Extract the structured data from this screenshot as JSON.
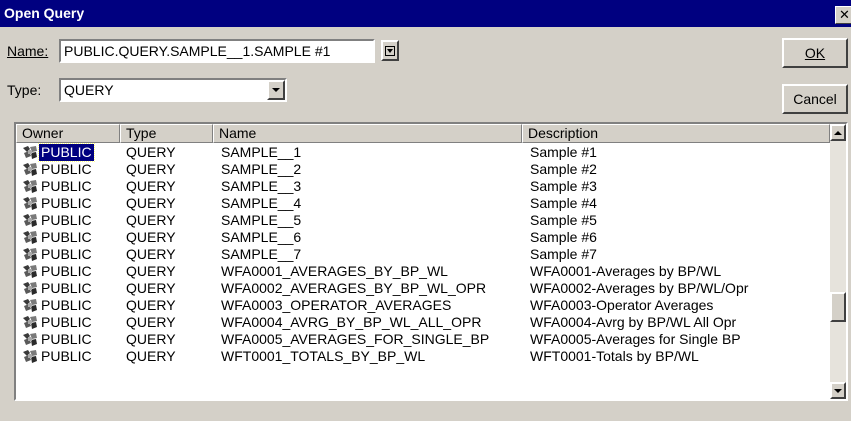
{
  "dialog": {
    "title": "Open Query",
    "close_glyph": "✕",
    "colors": {
      "titlebar": "#000080",
      "face": "#d4d0c8",
      "selection": "#000080"
    }
  },
  "form": {
    "name_label": "Name:",
    "name_value": "PUBLIC.QUERY.SAMPLE__1.SAMPLE #1",
    "type_label": "Type:",
    "type_value": "QUERY"
  },
  "buttons": {
    "ok": "OK",
    "cancel": "Cancel"
  },
  "list": {
    "columns": [
      "Owner",
      "Type",
      "Name",
      "Description"
    ],
    "owner_icon": "query-icon",
    "selected_index": 0,
    "rows": [
      {
        "owner": "PUBLIC",
        "type": "QUERY",
        "name": "SAMPLE__1",
        "description": "Sample #1"
      },
      {
        "owner": "PUBLIC",
        "type": "QUERY",
        "name": "SAMPLE__2",
        "description": "Sample #2"
      },
      {
        "owner": "PUBLIC",
        "type": "QUERY",
        "name": "SAMPLE__3",
        "description": "Sample #3"
      },
      {
        "owner": "PUBLIC",
        "type": "QUERY",
        "name": "SAMPLE__4",
        "description": "Sample #4"
      },
      {
        "owner": "PUBLIC",
        "type": "QUERY",
        "name": "SAMPLE__5",
        "description": "Sample #5"
      },
      {
        "owner": "PUBLIC",
        "type": "QUERY",
        "name": "SAMPLE__6",
        "description": "Sample #6"
      },
      {
        "owner": "PUBLIC",
        "type": "QUERY",
        "name": "SAMPLE__7",
        "description": "Sample #7"
      },
      {
        "owner": "PUBLIC",
        "type": "QUERY",
        "name": "WFA0001_AVERAGES_BY_BP_WL",
        "description": "WFA0001-Averages by BP/WL"
      },
      {
        "owner": "PUBLIC",
        "type": "QUERY",
        "name": "WFA0002_AVERAGES_BY_BP_WL_OPR",
        "description": "WFA0002-Averages by BP/WL/Opr"
      },
      {
        "owner": "PUBLIC",
        "type": "QUERY",
        "name": "WFA0003_OPERATOR_AVERAGES",
        "description": "WFA0003-Operator Averages"
      },
      {
        "owner": "PUBLIC",
        "type": "QUERY",
        "name": "WFA0004_AVRG_BY_BP_WL_ALL_OPR",
        "description": "WFA0004-Avrg by BP/WL All Opr"
      },
      {
        "owner": "PUBLIC",
        "type": "QUERY",
        "name": "WFA0005_AVERAGES_FOR_SINGLE_BP",
        "description": "WFA0005-Averages for Single BP"
      },
      {
        "owner": "PUBLIC",
        "type": "QUERY",
        "name": "WFT0001_TOTALS_BY_BP_WL",
        "description": "WFT0001-Totals by BP/WL"
      }
    ]
  }
}
